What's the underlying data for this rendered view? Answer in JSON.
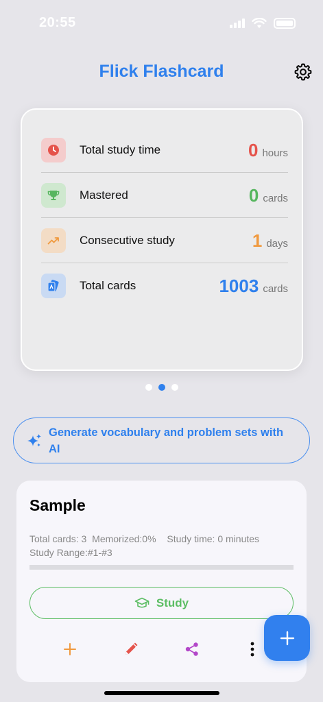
{
  "status_bar": {
    "time": "20:55"
  },
  "header": {
    "title": "Flick Flashcard",
    "settings_icon": "gear-icon"
  },
  "stats": [
    {
      "label": "Total study time",
      "value": "0",
      "unit": "hours",
      "color": "#e5534b",
      "icon": "clock-icon",
      "icon_bg": "#f4cccc"
    },
    {
      "label": "Mastered",
      "value": "0",
      "unit": "cards",
      "color": "#57b65f",
      "icon": "trophy-icon",
      "icon_bg": "#cfe8cf"
    },
    {
      "label": "Consecutive study",
      "value": "1",
      "unit": "days",
      "color": "#f0993e",
      "icon": "trend-up-icon",
      "icon_bg": "#f3dcc5"
    },
    {
      "label": "Total cards",
      "value": "1003",
      "unit": "cards",
      "color": "#2f80ed",
      "icon": "cards-icon",
      "icon_bg": "#c9daf3"
    }
  ],
  "carousel": {
    "pages": 3,
    "active_index": 1
  },
  "ai_generate": {
    "label": "Generate vocabulary and problem sets with AI",
    "icon": "sparkles-icon"
  },
  "deck": {
    "name": "Sample",
    "total_cards": "Total cards: 3",
    "memorized": "Memorized:0%",
    "study_time": "Study time: 0 minutes",
    "study_range": "Study Range:#1-#3",
    "progress": 0,
    "study_label": "Study",
    "actions": [
      "plus-icon",
      "pencil-icon",
      "share-icon",
      "more-vertical-icon"
    ]
  },
  "fab": {
    "icon": "plus-icon"
  },
  "colors": {
    "accent": "#2f80ed",
    "study_green": "#5bbd63",
    "add_orange": "#f0993e",
    "edit_red": "#e5534b",
    "share_purple": "#b347c9"
  }
}
